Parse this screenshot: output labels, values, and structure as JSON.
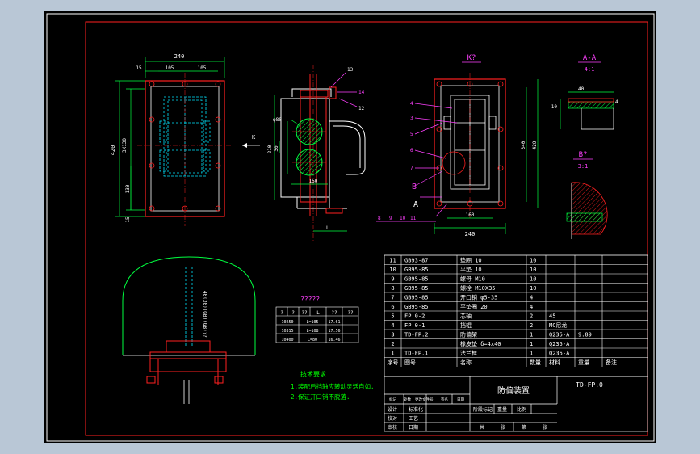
{
  "views": {
    "front": {
      "dims": [
        "240",
        "15",
        "105",
        "105",
        "420",
        "3X130",
        "130",
        "15"
      ]
    },
    "side": {
      "dims": [
        "φ80",
        "30",
        "210",
        "150",
        "L"
      ],
      "callouts": [
        "13",
        "14",
        "12"
      ],
      "arrow_label": "K"
    },
    "kview": {
      "title": "K?",
      "callouts": [
        "4",
        "3",
        "5",
        "6",
        "7"
      ],
      "bottom_callouts": [
        "8",
        "9",
        "10",
        "11"
      ],
      "dims": [
        "160",
        "240",
        "340",
        "420"
      ],
      "section_a": "A",
      "section_b": "B"
    },
    "section_aa": {
      "title": "A-A",
      "scale": "4:1",
      "dims": [
        "40",
        "10",
        "4"
      ]
    },
    "section_b": {
      "title": "B?",
      "scale": "3:1"
    }
  },
  "small_table": {
    "title": "?????",
    "headers": [
      "?",
      "?",
      "??",
      "L",
      "??",
      "??"
    ],
    "rows": [
      [
        "10250",
        "L=105",
        "17.61"
      ],
      [
        "10315",
        "L=108",
        "17.56"
      ],
      [
        "10400",
        "L=80",
        "16.46"
      ]
    ]
  },
  "vertical_label": "40(30)(GB)(GB)??",
  "tech_notes": {
    "title": "技术要求",
    "lines": [
      "1.装配后挡轴应转动灵活自如.",
      "2.保证开口销不脱落."
    ]
  },
  "bom": {
    "rows": [
      [
        "11",
        "GB93-87",
        "垫圈 10",
        "10",
        "",
        "",
        ""
      ],
      [
        "10",
        "GB95-85",
        "平垫 10",
        "10",
        "",
        "",
        ""
      ],
      [
        "9",
        "GB95-85",
        "螺母 M10",
        "10",
        "",
        "",
        ""
      ],
      [
        "8",
        "GB95-85",
        "螺栓 M10X35",
        "10",
        "",
        "",
        ""
      ],
      [
        "7",
        "GB95-85",
        "开口销 φ5-35",
        "4",
        "",
        "",
        ""
      ],
      [
        "6",
        "GB95-85",
        "平垫圈 20",
        "4",
        "",
        "",
        ""
      ],
      [
        "5",
        "FP.0-2",
        "芯轴",
        "2",
        "45",
        "",
        ""
      ],
      [
        "4",
        "FP.0-1",
        "挡辊",
        "2",
        "MC尼龙",
        "",
        ""
      ],
      [
        "3",
        "TD-FP.2",
        "防偏架",
        "1",
        "Q235-A",
        "9.89",
        ""
      ],
      [
        "2",
        "",
        "橡皮垫 δ=4x40",
        "1",
        "Q235-A",
        "",
        ""
      ],
      [
        "1",
        "TD-FP.1",
        "法兰框",
        "1",
        "Q235-A",
        "",
        ""
      ]
    ],
    "header": [
      "序号",
      "图号",
      "名称",
      "数量",
      "材料",
      "重量",
      "备注"
    ]
  },
  "title_block": {
    "name": "防偏装置",
    "drawing_no": "TD-FP.0",
    "revision_row": [
      "标记",
      "处数",
      "更改文件号",
      "签名",
      "日期"
    ],
    "labels": {
      "design": "设计",
      "std": "标准化",
      "check": "校对",
      "review": "审核",
      "process": "工艺",
      "approve": "批准",
      "date": "日期",
      "stage": "阶段标记",
      "weight": "重量",
      "scale": "比例",
      "total": "共",
      "sheet_word": "张",
      "page": "第",
      "sheet_word2": "张"
    }
  },
  "colors": {
    "canvas": "#000000",
    "border": "#ff2020",
    "outline": "#ffffff",
    "hidden": "#00e5ff",
    "dim": "#00ff40",
    "callout": "#ff40ff",
    "text": "#ffffff",
    "note": "#00ff00",
    "table_line": "#ffffff"
  }
}
